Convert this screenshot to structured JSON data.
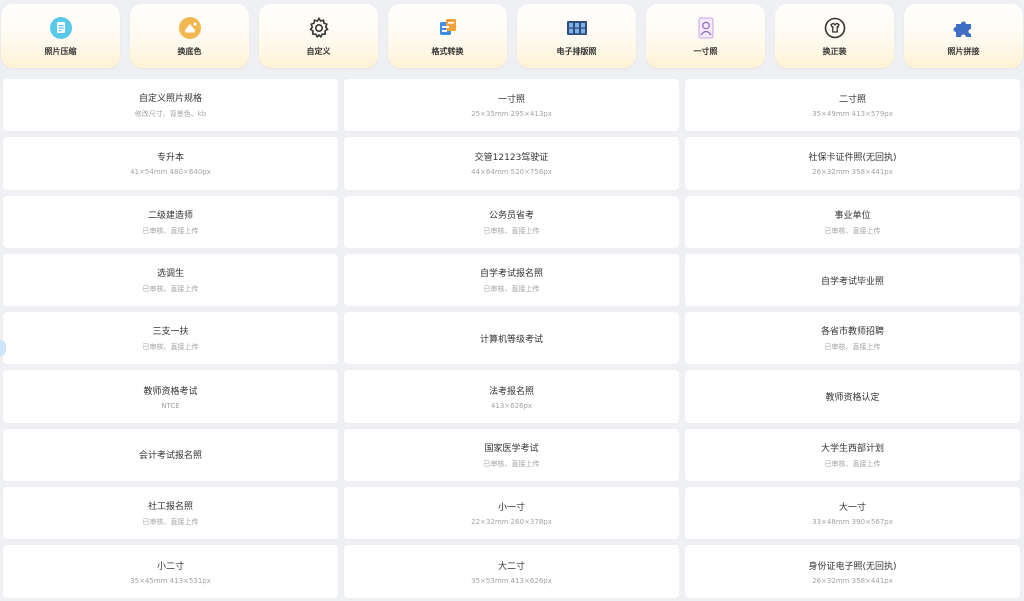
{
  "tools": [
    {
      "label": "照片压缩",
      "icon": "photo-compress-icon"
    },
    {
      "label": "换底色",
      "icon": "change-background-icon"
    },
    {
      "label": "自定义",
      "icon": "gear-icon"
    },
    {
      "label": "格式转换",
      "icon": "format-convert-icon"
    },
    {
      "label": "电子排版照",
      "icon": "layout-grid-icon"
    },
    {
      "label": "一寸照",
      "icon": "portrait-icon"
    },
    {
      "label": "换正装",
      "icon": "shirt-icon"
    },
    {
      "label": "照片拼接",
      "icon": "puzzle-icon"
    }
  ],
  "cards": [
    {
      "title": "自定义照片规格",
      "sub": "修改尺寸、背景色、kb"
    },
    {
      "title": "一寸照",
      "sub": "25×35mm 295×413px"
    },
    {
      "title": "二寸照",
      "sub": "35×49mm 413×579px"
    },
    {
      "title": "专升本",
      "sub": "41×54mm 480×640px"
    },
    {
      "title": "交管12123驾驶证",
      "sub": "44×64mm 520×756px"
    },
    {
      "title": "社保卡证件照(无回执)",
      "sub": "26×32mm 358×441px"
    },
    {
      "title": "二级建造师",
      "sub": "已审核、直接上传"
    },
    {
      "title": "公务员省考",
      "sub": "已审核、直接上传"
    },
    {
      "title": "事业单位",
      "sub": "已审核、直接上传"
    },
    {
      "title": "选调生",
      "sub": "已审核、直接上传"
    },
    {
      "title": "自学考试报名照",
      "sub": "已审核、直接上传"
    },
    {
      "title": "自学考试毕业照",
      "sub": ""
    },
    {
      "title": "三支一扶",
      "sub": "已审核、直接上传"
    },
    {
      "title": "计算机等级考试",
      "sub": ""
    },
    {
      "title": "各省市教师招聘",
      "sub": "已审核、直接上传"
    },
    {
      "title": "教师资格考试",
      "sub": "NTCE"
    },
    {
      "title": "法考报名照",
      "sub": "413×626px"
    },
    {
      "title": "教师资格认定",
      "sub": ""
    },
    {
      "title": "会计考试报名照",
      "sub": ""
    },
    {
      "title": "国家医学考试",
      "sub": "已审核、直接上传"
    },
    {
      "title": "大学生西部计划",
      "sub": "已审核、直接上传"
    },
    {
      "title": "社工报名照",
      "sub": "已审核、直接上传"
    },
    {
      "title": "小一寸",
      "sub": "22×32mm 260×378px"
    },
    {
      "title": "大一寸",
      "sub": "33×48mm 390×567px"
    },
    {
      "title": "小二寸",
      "sub": "35×45mm 413×531px"
    },
    {
      "title": "大二寸",
      "sub": "35×53mm 413×626px"
    },
    {
      "title": "身份证电子照(无回执)",
      "sub": "26×32mm 358×441px"
    }
  ]
}
